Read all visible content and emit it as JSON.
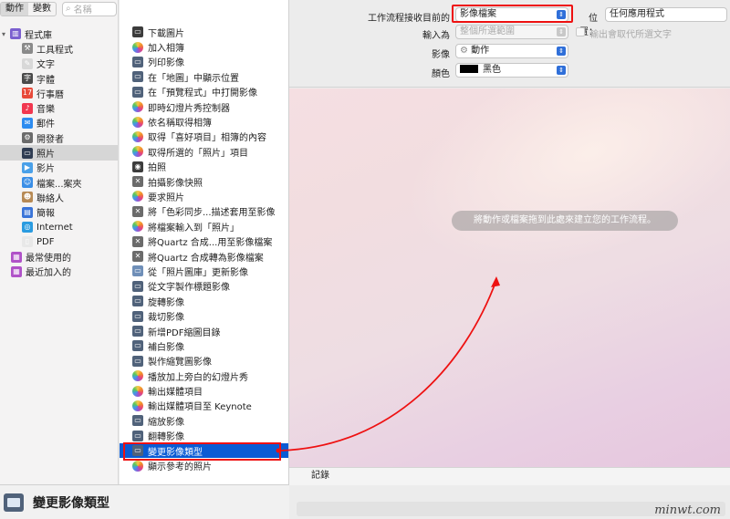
{
  "toolbar": {
    "tab_actions": "動作",
    "tab_variables": "變數",
    "search_placeholder": "名稱"
  },
  "library": {
    "root": "程式庫",
    "items": [
      {
        "label": "工具程式",
        "icon": "tools-icon",
        "color": "#8a8a8a",
        "glyph": "⚒"
      },
      {
        "label": "文字",
        "icon": "text-icon",
        "color": "#d8d8d8",
        "glyph": "✎"
      },
      {
        "label": "字體",
        "icon": "font-icon",
        "color": "#4a4a4a",
        "glyph": "字"
      },
      {
        "label": "行事曆",
        "icon": "calendar-icon",
        "color": "#e84a3a",
        "glyph": "17"
      },
      {
        "label": "音樂",
        "icon": "music-icon",
        "color": "#f1374f",
        "glyph": "♪"
      },
      {
        "label": "郵件",
        "icon": "mail-icon",
        "color": "#2d8cf0",
        "glyph": "✉"
      },
      {
        "label": "開發者",
        "icon": "developer-icon",
        "color": "#6b6b6b",
        "glyph": "⚙"
      },
      {
        "label": "照片",
        "icon": "photos-icon",
        "color": "#2f3c52",
        "glyph": "▭"
      },
      {
        "label": "影片",
        "icon": "movies-icon",
        "color": "#4aa0e8",
        "glyph": "▶"
      },
      {
        "label": "檔案...案夾",
        "icon": "finder-icon",
        "color": "#3a8ee6",
        "glyph": "☺"
      },
      {
        "label": "聯絡人",
        "icon": "contacts-icon",
        "color": "#b78a55",
        "glyph": "☻"
      },
      {
        "label": "簡報",
        "icon": "presentation-icon",
        "color": "#3a74d8",
        "glyph": "▤"
      },
      {
        "label": "Internet",
        "icon": "internet-icon",
        "color": "#2a9be0",
        "glyph": "◎"
      },
      {
        "label": "PDF",
        "icon": "pdf-icon",
        "color": "#e8e8e8",
        "glyph": "▯"
      }
    ],
    "smart": [
      {
        "label": "最常使用的",
        "icon": "most-used-icon",
        "color": "#b052c8",
        "glyph": "▦"
      },
      {
        "label": "最近加入的",
        "icon": "recently-added-icon",
        "color": "#b052c8",
        "glyph": "▦"
      }
    ]
  },
  "actions": [
    {
      "label": "下載圖片",
      "icon": "download-images-icon",
      "color": "#3c3c3c"
    },
    {
      "label": "加入相簿",
      "icon": "photos-app-icon",
      "color": "#f08a2a"
    },
    {
      "label": "列印影像",
      "icon": "preview-icon",
      "color": "#50627a"
    },
    {
      "label": "在「地圖」中顯示位置",
      "icon": "preview-icon",
      "color": "#50627a"
    },
    {
      "label": "在「預覽程式」中打開影像",
      "icon": "preview-icon",
      "color": "#50627a"
    },
    {
      "label": "即時幻燈片秀控制器",
      "icon": "photos-app-icon",
      "color": "#f08a2a"
    },
    {
      "label": "依名稱取得相簿",
      "icon": "photos-app-icon",
      "color": "#f08a2a"
    },
    {
      "label": "取得「喜好項目」相簿的內容",
      "icon": "photos-app-icon",
      "color": "#f08a2a"
    },
    {
      "label": "取得所選的「照片」項目",
      "icon": "photos-app-icon",
      "color": "#f08a2a"
    },
    {
      "label": "拍照",
      "icon": "camera-icon",
      "color": "#3c3c3c"
    },
    {
      "label": "拍攝影像快照",
      "icon": "automator-icon",
      "color": "#6b6b6b"
    },
    {
      "label": "要求照片",
      "icon": "photos-app-icon",
      "color": "#f08a2a"
    },
    {
      "label": "將「色彩同步...描述套用至影像",
      "icon": "automator-icon",
      "color": "#6b6b6b"
    },
    {
      "label": "將檔案輸入到「照片」",
      "icon": "photos-app-icon",
      "color": "#f08a2a"
    },
    {
      "label": "將Quartz 合成...用至影像檔案",
      "icon": "automator-icon",
      "color": "#6b6b6b"
    },
    {
      "label": "將Quartz 合成轉為影像檔案",
      "icon": "automator-icon",
      "color": "#6b6b6b"
    },
    {
      "label": "從「照片圖庫」更新影像",
      "icon": "image-capture-icon",
      "color": "#6f8fb8"
    },
    {
      "label": "從文字製作標題影像",
      "icon": "preview-icon",
      "color": "#50627a"
    },
    {
      "label": "旋轉影像",
      "icon": "preview-icon",
      "color": "#50627a"
    },
    {
      "label": "裁切影像",
      "icon": "preview-icon",
      "color": "#50627a"
    },
    {
      "label": "新增PDF縮圖目錄",
      "icon": "preview-icon",
      "color": "#50627a"
    },
    {
      "label": "補白影像",
      "icon": "preview-icon",
      "color": "#50627a"
    },
    {
      "label": "製作縮覽圖影像",
      "icon": "preview-icon",
      "color": "#50627a"
    },
    {
      "label": "播放加上旁白的幻燈片秀",
      "icon": "photos-app-icon",
      "color": "#f08a2a"
    },
    {
      "label": "輸出媒體項目",
      "icon": "photos-app-icon",
      "color": "#f08a2a"
    },
    {
      "label": "輸出媒體項目至 Keynote",
      "icon": "photos-app-icon",
      "color": "#f08a2a"
    },
    {
      "label": "縮放影像",
      "icon": "preview-icon",
      "color": "#50627a"
    },
    {
      "label": "翻轉影像",
      "icon": "preview-icon",
      "color": "#50627a"
    },
    {
      "label": "變更影像類型",
      "icon": "preview-icon",
      "color": "#50627a",
      "selected": true
    },
    {
      "label": "顯示參考的照片",
      "icon": "photos-app-icon",
      "color": "#f08a2a"
    }
  ],
  "description": {
    "title": "變更影像類型"
  },
  "workflow": {
    "receives_label": "工作流程接收目前的",
    "receives_value": "影像檔案",
    "location_label": "位置：",
    "location_value": "任何應用程式",
    "input_label": "輸入為",
    "input_value": "整個所選範圍",
    "output_replaces": "輸出會取代所選文字",
    "image_label": "影像",
    "image_value": "動作",
    "color_label": "顏色",
    "color_value": "黑色",
    "drop_hint": "將動作或檔案拖到此處來建立您的工作流程。",
    "log_label": "記錄"
  },
  "colors": {
    "selection": "#0a5bd4",
    "annotation": "#e11111",
    "accent": "#2f6fd9"
  },
  "watermark": "minwt.com"
}
